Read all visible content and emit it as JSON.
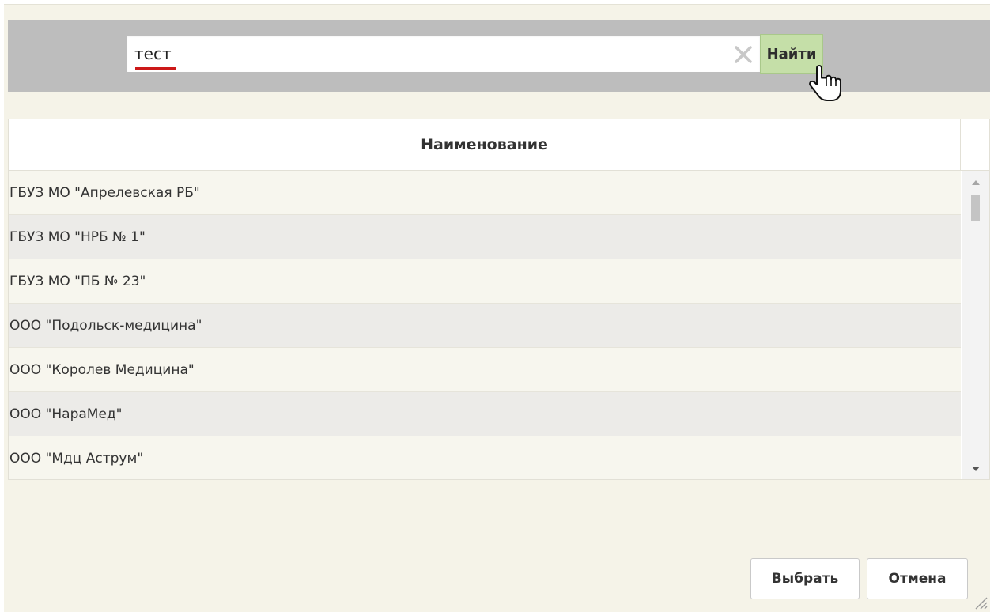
{
  "search": {
    "value": "тест",
    "clear_icon": "close-icon",
    "find_label": "Найти"
  },
  "grid": {
    "column_header": "Наименование",
    "rows": [
      "ГБУЗ МО \"Апрелевская РБ\"",
      "ГБУЗ МО \"НРБ № 1\"",
      "ГБУЗ МО \"ПБ № 23\"",
      "ООО \"Подольск-медицина\"",
      "ООО \"Королев Медицина\"",
      "ООО \"НараМед\"",
      "ООО \"Мдц Аструм\""
    ]
  },
  "footer": {
    "select_label": "Выбрать",
    "cancel_label": "Отмена"
  },
  "colors": {
    "find_button_bg": "#c5dfa8",
    "search_bar_bg": "#bdbdbd",
    "dialog_bg": "#f5f3e8",
    "spell_underline": "#cc1818"
  }
}
